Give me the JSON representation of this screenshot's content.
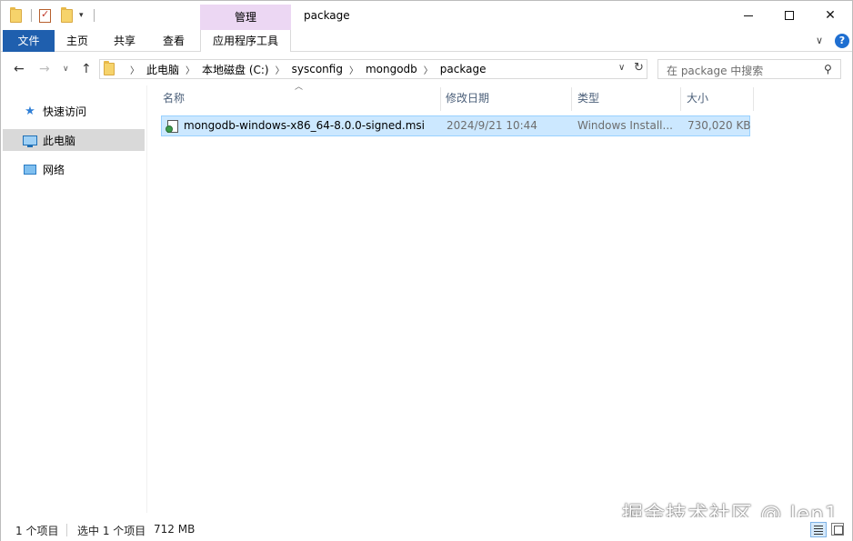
{
  "window": {
    "title": "package",
    "context_tab_group": "管理"
  },
  "ribbon": {
    "tabs": [
      {
        "label": "文件"
      },
      {
        "label": "主页"
      },
      {
        "label": "共享"
      },
      {
        "label": "查看"
      },
      {
        "label": "应用程序工具"
      }
    ]
  },
  "address": {
    "breadcrumbs": [
      "此电脑",
      "本地磁盘 (C:)",
      "sysconfig",
      "mongodb",
      "package"
    ]
  },
  "search": {
    "placeholder": "在 package 中搜索"
  },
  "nav_pane": {
    "items": [
      {
        "label": "快速访问",
        "icon": "star-icon"
      },
      {
        "label": "此电脑",
        "icon": "computer-icon",
        "selected": true
      },
      {
        "label": "网络",
        "icon": "network-icon"
      }
    ]
  },
  "columns": {
    "name": "名称",
    "date": "修改日期",
    "type": "类型",
    "size": "大小"
  },
  "files": [
    {
      "name": "mongodb-windows-x86_64-8.0.0-signed.msi",
      "date": "2024/9/21 10:44",
      "type": "Windows Install...",
      "size": "730,020 KB",
      "icon": "msi-installer-icon",
      "selected": true
    }
  ],
  "status": {
    "item_count": "1 个项目",
    "selected": "选中 1 个项目",
    "selected_size": "712 MB"
  },
  "watermark": "掘金技术社区 @ len1",
  "colors": {
    "accent": "#1f5fae",
    "context_tab": "#ecd7f3",
    "selection": "#cce8ff",
    "selection_border": "#99d1ff"
  }
}
